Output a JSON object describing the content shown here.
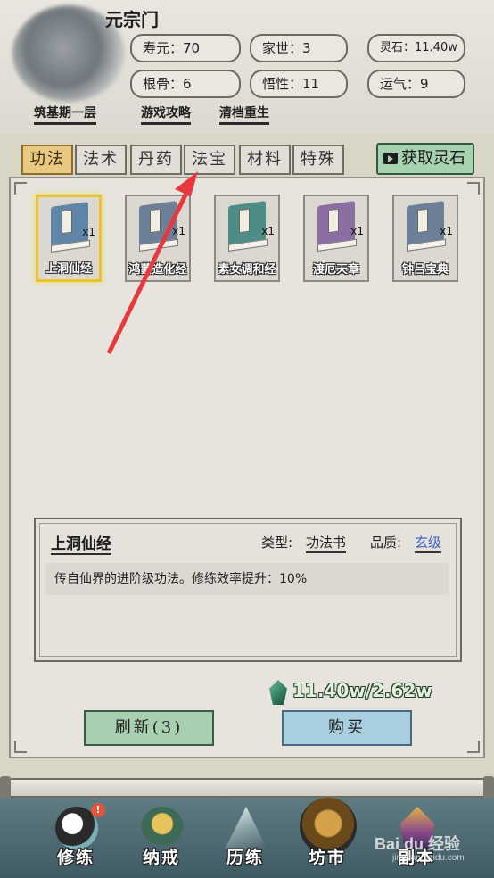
{
  "header": {
    "sect_name": "元宗门",
    "stats": {
      "shouyuan": "寿元：70",
      "jiashi": "家世：3",
      "lingshi": "灵石：11.40w",
      "gengu": "根骨：6",
      "wuxing": "悟性：11",
      "yunqi": "运气：9"
    },
    "quick_links": {
      "realm": "筑基期一层",
      "guide": "游戏攻略",
      "reset": "清档重生"
    }
  },
  "tabs": [
    {
      "label": "功法",
      "active": true
    },
    {
      "label": "法术",
      "active": false
    },
    {
      "label": "丹药",
      "active": false
    },
    {
      "label": "法宝",
      "active": false
    },
    {
      "label": "材料",
      "active": false
    },
    {
      "label": "特殊",
      "active": false
    }
  ],
  "get_stones_label": "获取灵石",
  "items": [
    {
      "name": "上洞仙经",
      "qty": "x1",
      "color": "#5f86a8",
      "selected": true
    },
    {
      "name": "鸿蒙造化经",
      "qty": "x1",
      "color": "#6b7f96",
      "selected": false
    },
    {
      "name": "素女调和经",
      "qty": "x1",
      "color": "#4e8c86",
      "selected": false
    },
    {
      "name": "渡厄天章",
      "qty": "x1",
      "color": "#8b6fa3",
      "selected": false
    },
    {
      "name": "钟吕宝典",
      "qty": "x1",
      "color": "#6e7f98",
      "selected": false
    }
  ],
  "detail": {
    "name": "上洞仙经",
    "type_label": "类型:",
    "type_value": "功法书",
    "quality_label": "品质:",
    "quality_value": "玄级",
    "description": "传自仙界的进阶级功法。修练效率提升：10%"
  },
  "currency": "11.40w/2.62w",
  "buttons": {
    "refresh": "刷新(3)",
    "buy": "购买"
  },
  "nav": [
    {
      "label": "修练",
      "icon": "yin-yang-icon",
      "badge": "!"
    },
    {
      "label": "纳戒",
      "icon": "ring-icon",
      "badge": ""
    },
    {
      "label": "历练",
      "icon": "mountain-icon",
      "badge": ""
    },
    {
      "label": "坊市",
      "icon": "cauldron-icon",
      "badge": ""
    },
    {
      "label": "副本",
      "icon": "pagoda-icon",
      "badge": ""
    }
  ],
  "watermark": "Bai du 经验",
  "watermark_sub": "jingyan.baidu.com"
}
